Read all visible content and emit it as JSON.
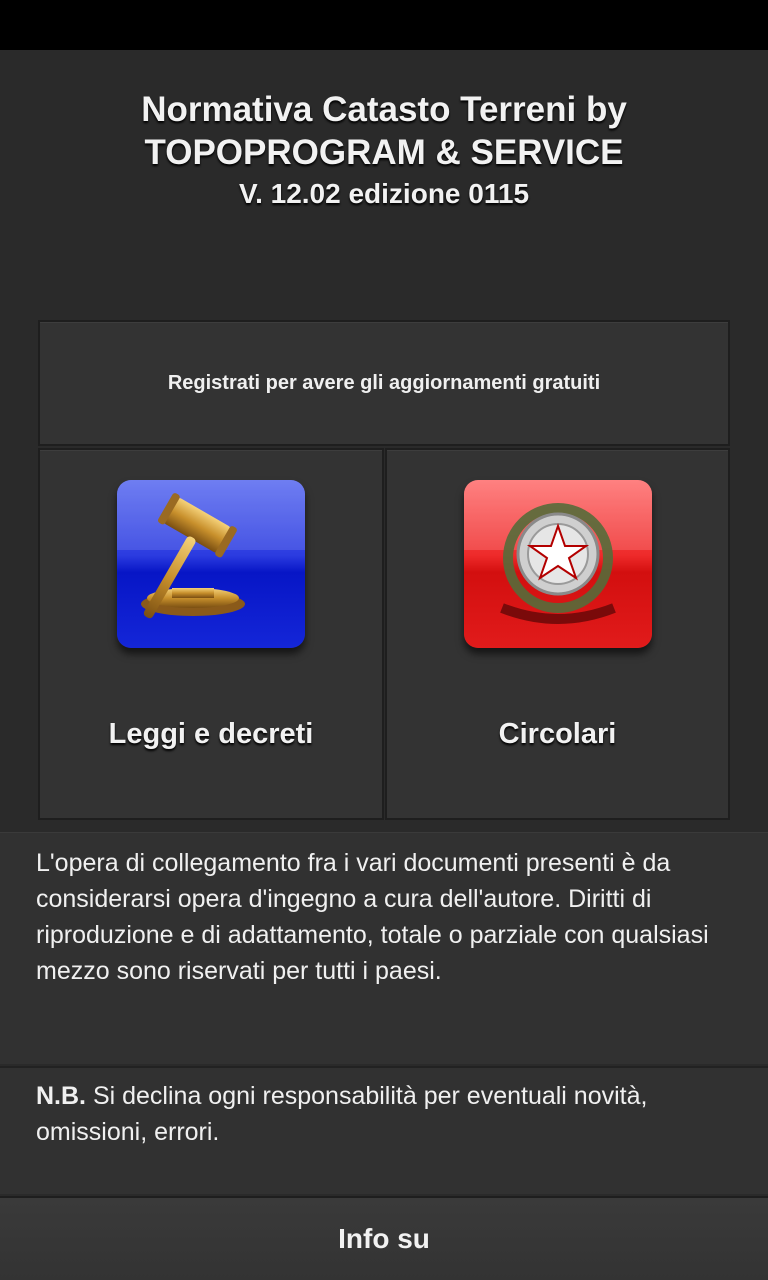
{
  "header": {
    "title_line1": "Normativa Catasto Terreni by",
    "title_line2": "TOPOPROGRAM & SERVICE",
    "version": "V. 12.02 edizione 0115"
  },
  "register_button": {
    "label": "Registrati per avere gli aggiornamenti gratuiti"
  },
  "tiles": [
    {
      "label": "Leggi e decreti",
      "icon": "gavel-icon",
      "color": "#1426d8"
    },
    {
      "label": "Circolari",
      "icon": "italian-emblem-icon",
      "color": "#e11b1b"
    }
  ],
  "notice": {
    "text": "L'opera di collegamento fra i vari documenti presenti è da considerarsi opera d'ingegno a cura dell'autore. Diritti di riproduzione e di adattamento, totale o parziale con qualsiasi mezzo sono riservati per tutti i paesi."
  },
  "disclaimer": {
    "prefix": "N.B.",
    "text": " Si declina ogni responsabilità per eventuali novità, omissioni, errori."
  },
  "info_button": {
    "label": "Info su"
  }
}
